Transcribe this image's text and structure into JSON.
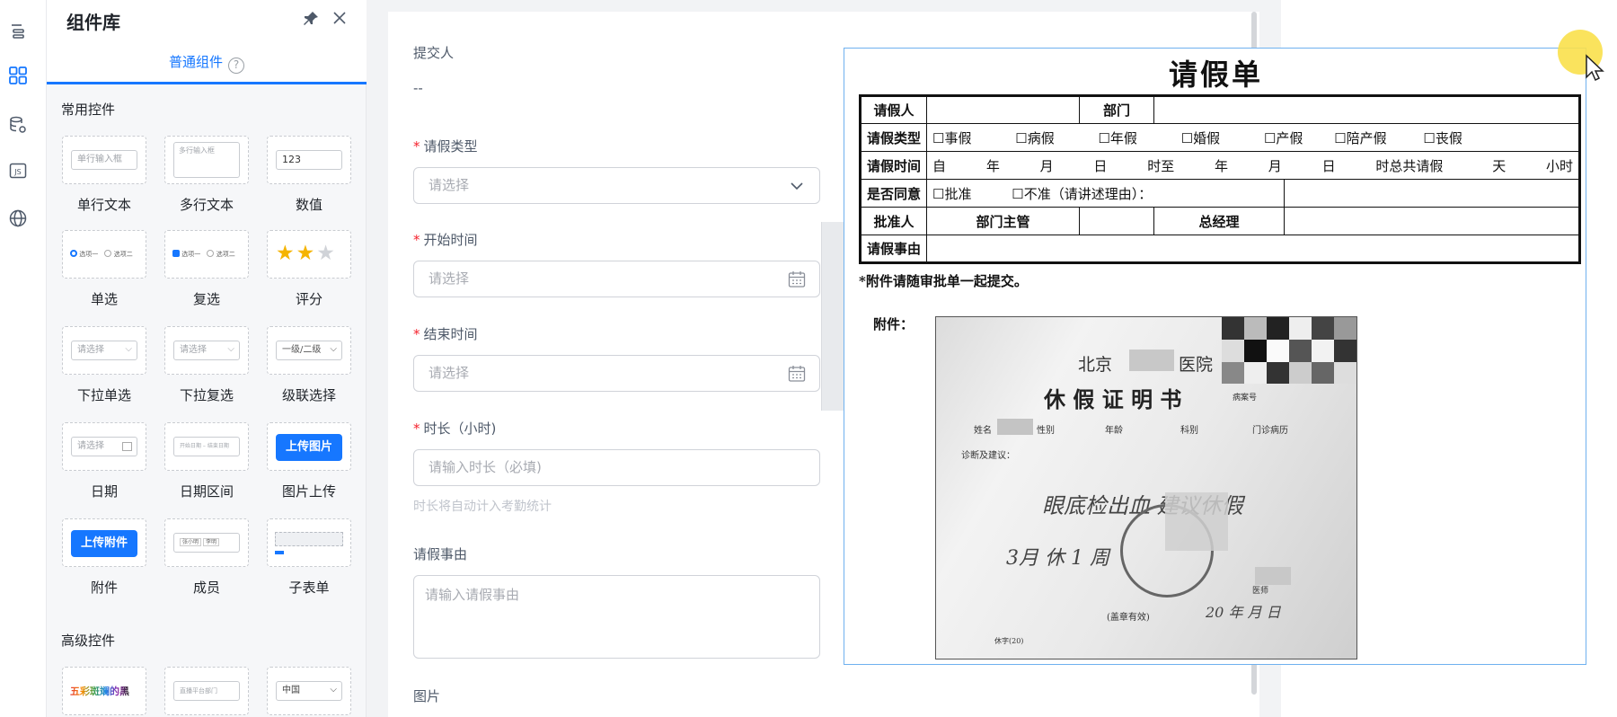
{
  "panel": {
    "title": "组件库",
    "tab": "普通组件",
    "help": "?",
    "section_basic": "常用控件",
    "section_advanced": "高级控件"
  },
  "components": {
    "single_text": {
      "label": "单行文本",
      "preview": "单行输入框"
    },
    "multi_text": {
      "label": "多行文本",
      "preview": "多行输入框"
    },
    "number": {
      "label": "数值",
      "preview": "123"
    },
    "radio": {
      "label": "单选",
      "preview_a": "选项一",
      "preview_b": "选项二"
    },
    "checkbox": {
      "label": "复选",
      "preview_a": "选项一",
      "preview_b": "选项二"
    },
    "rating": {
      "label": "评分",
      "value": 2,
      "max": 3
    },
    "dropdown_single": {
      "label": "下拉单选",
      "preview": "请选择"
    },
    "dropdown_multi": {
      "label": "下拉复选",
      "preview": "请选择"
    },
    "cascade": {
      "label": "级联选择",
      "preview": "一级/二级"
    },
    "date": {
      "label": "日期",
      "preview": "请选择"
    },
    "date_range": {
      "label": "日期区间",
      "preview_a": "开始日期",
      "preview_b": "结束日期"
    },
    "image_upload": {
      "label": "图片上传",
      "button": "上传图片"
    },
    "attachment": {
      "label": "附件",
      "button": "上传附件"
    },
    "member": {
      "label": "成员",
      "preview_a": "张小明",
      "preview_b": "李明"
    },
    "subtable": {
      "label": "子表单"
    },
    "adv_color": {
      "preview": "五彩斑斓的黑"
    },
    "adv_dept": {
      "preview": "直播平台部门"
    },
    "adv_region": {
      "preview": "中国"
    }
  },
  "form": {
    "submitter_label": "提交人",
    "submitter_value": "--",
    "leave_type": {
      "label": "请假类型",
      "placeholder": "请选择"
    },
    "start_time": {
      "label": "开始时间",
      "placeholder": "请选择"
    },
    "end_time": {
      "label": "结束时间",
      "placeholder": "请选择"
    },
    "duration": {
      "label": "时长（小时)",
      "placeholder": "请输入时长（必填)",
      "hint": "时长将自动计入考勤统计"
    },
    "reason": {
      "label": "请假事由",
      "placeholder": "请输入请假事由"
    },
    "image_label": "图片",
    "required_mark": "*"
  },
  "doc": {
    "title": "请假单",
    "row1": {
      "applicant": "请假人",
      "dept": "部门"
    },
    "row2": {
      "label": "请假类型",
      "options": [
        "☐事假",
        "☐病假",
        "☐年假",
        "☐婚假",
        "☐产假",
        "☐陪产假",
        "☐丧假"
      ]
    },
    "row3": {
      "label": "请假时间",
      "from": "自",
      "year": "年",
      "month": "月",
      "day": "日",
      "time_to": "时至",
      "year2": "年",
      "month2": "月",
      "day2": "日",
      "total": "时总共请假",
      "days": "天",
      "hours": "小时"
    },
    "row4": {
      "label": "是否同意",
      "approve": "☐批准",
      "reject": "☐不准（请讲述理由）："
    },
    "row5": {
      "label": "批准人",
      "dept_head": "部门主管",
      "gm": "总经理"
    },
    "row6": {
      "label": "请假事由"
    },
    "note": "*附件请随审批单一起提交。",
    "attach_label": "附件：",
    "cert": {
      "hospital_a": "北京",
      "hospital_b": "医院",
      "title": "休 假 证 明 书",
      "serial": "病案号",
      "name": "姓名",
      "sex": "性别",
      "age": "年龄",
      "dept": "科别",
      "clinic": "门诊病历",
      "diag": "诊断及建议：",
      "hand1": "眼底检出血 建议休假",
      "hand2": "3月 休 1 周",
      "seal_note": "(盖章有效)",
      "doctor": "医师",
      "date": "20  年  月  日",
      "footer": "休字(20)"
    }
  }
}
